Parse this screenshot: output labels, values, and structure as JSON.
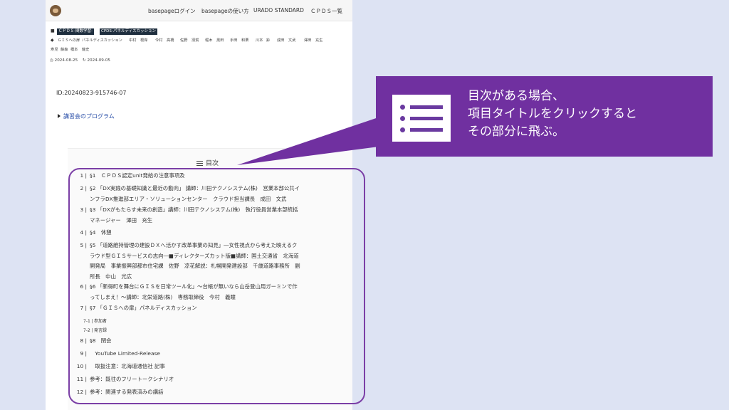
{
  "nav": {
    "links": [
      "basepageログイン",
      "basepageの使い方",
      "URADO STANDARD",
      "ＣＰＤＳ一覧"
    ]
  },
  "tags": {
    "categories": [
      "ＣＰＤＳ-関数学習-",
      "CPDS-パネルディスカッション"
    ],
    "keywords_row1": [
      "ＧＩＳへの扉",
      "パネルディスカッション",
      "中村",
      "根岸",
      "今村",
      "高橋",
      "佐野",
      "須賀",
      "堀木",
      "黒田",
      "手田",
      "和栗",
      "川本",
      "鈴",
      "成田",
      "文武",
      "澤田",
      "充生"
    ],
    "keywords_row2": [
      "寿児",
      "藤森",
      "橋本",
      "龍史"
    ]
  },
  "dates": {
    "published": "2024-08-25",
    "updated": "2024-09-05"
  },
  "doc_id": "ID:20240823-915746-07",
  "program_link": "講習会のプログラム",
  "toc": {
    "title": "目次",
    "items": [
      {
        "num": "1 |",
        "lines": [
          "§1　ＣＰＤＳ認定unit発給の注意事項及"
        ]
      },
      {
        "num": "2 |",
        "lines": [
          "§2 「DX実践の基礎知識と最近の動向」 講師：川田テクノシステム(株)　営業本部公共イ",
          "ンフラDX推進部エリア・ソリューションセンター　クラウド担当課長　成田　文武"
        ]
      },
      {
        "num": "3 |",
        "lines": [
          "§3 「DXがもたらす未来の創造」講師：川田テクノシステム(株)　執行役員営業本部統括",
          "マネージャー　澤田　充生"
        ]
      },
      {
        "num": "4 |",
        "lines": [
          "§4　休憩"
        ]
      },
      {
        "num": "5 |",
        "lines": [
          "§5 「道路維持管理の建設ＤＸへ活かす改革事業の知見」―女性視点から考えた映えるク",
          "ラウド型ＧＩＳサービスの志向―■ディレクターズカット版■講師：国土交通省　北海道",
          "開発局　事業振興部都市住宅課　佐野　凉花解説：札幌開発建設部　千歳道路事務所　副",
          "所長　中山　光広"
        ]
      },
      {
        "num": "6 |",
        "lines": [
          "§6 「新得町を舞台にＧＩＳを日常ツール化」～台帳が無いなら山岳登山用ガーミンで作",
          "ってしまえ！～講師：北栄道路(株)　専務取締役　今村　義瞳"
        ]
      },
      {
        "num": "7 |",
        "lines": [
          "§7 「ＧＩＳへの扉」パネルディスカッション"
        ]
      },
      {
        "num": "8 |",
        "lines": [
          "§8　閉会"
        ]
      },
      {
        "num": "9 |",
        "lines": [
          "　YouTube Limited-Release"
        ]
      },
      {
        "num": "10 |",
        "lines": [
          "　取扱注意：北海道通信社 記事"
        ]
      },
      {
        "num": "11 |",
        "lines": [
          "参考：既往のフリートークシナリオ"
        ]
      },
      {
        "num": "12 |",
        "lines": [
          "参考：関連する発表済みの講話"
        ]
      }
    ],
    "subitems": [
      {
        "num": "7-1 |",
        "label": "参加者"
      },
      {
        "num": "7-2 |",
        "label": "発言録"
      }
    ]
  },
  "callout": {
    "icon": "list-icon",
    "lines": [
      "目次がある場合、",
      "項目タイトルをクリックすると",
      "その部分に飛ぶ。"
    ],
    "color": "#7030a0"
  }
}
